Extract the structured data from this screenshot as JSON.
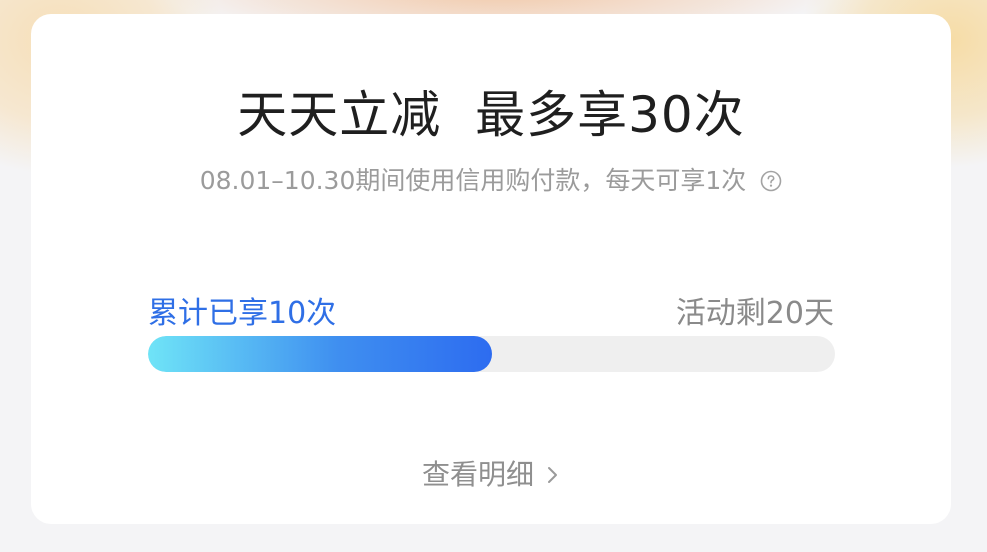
{
  "card": {
    "title": "天天立减  最多享30次",
    "subtitle": "08.01–10.30期间使用信用购付款，每天可享1次",
    "help_icon": "question-circle-icon",
    "progress": {
      "used_label": "累计已享10次",
      "remaining_label": "活动剩20天",
      "used_count": 10,
      "total_count": 30,
      "fill_fraction": 0.5
    },
    "detail_link": "查看明细",
    "detail_icon": "chevron-right-icon"
  },
  "colors": {
    "accent_blue": "#2f6fe6",
    "progress_start": "#6fe4f7",
    "progress_end": "#2d6cf0",
    "track": "#efefef"
  }
}
